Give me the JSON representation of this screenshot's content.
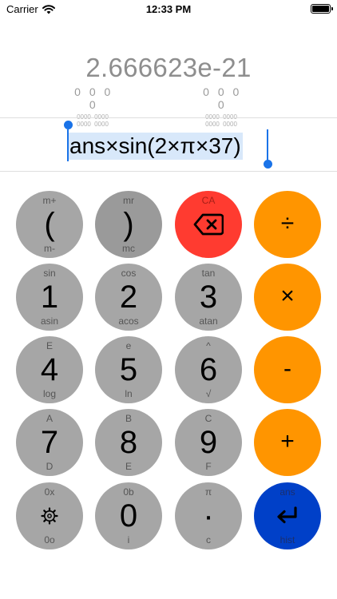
{
  "status_bar": {
    "carrier": "Carrier",
    "time": "12:33 PM",
    "icons": [
      "wifi-icon",
      "battery-icon"
    ]
  },
  "display": {
    "result": "2.666623e-21",
    "bit_groups": [
      {
        "digits": "0 0 0 0",
        "subs": "0000 0000 0000 0000"
      },
      {
        "digits": "0 0 0 0",
        "subs": "0000 0000 0000 0000"
      }
    ],
    "expression": "ans×sin(2×π×37)"
  },
  "colors": {
    "operator": "#ff9500",
    "delete": "#ff3b30",
    "enter": "#0040c8",
    "key": "#a6a6a6",
    "selection": "#1a73e8"
  },
  "keypad": {
    "open_paren": {
      "top": "m+",
      "main": "(",
      "bottom": "m-"
    },
    "close_paren": {
      "top": "mr",
      "main": ")",
      "bottom": "mc"
    },
    "backspace": {
      "top": "CA",
      "icon": "backspace-icon"
    },
    "divide": {
      "main": "÷"
    },
    "one": {
      "top": "sin",
      "main": "1",
      "bottom": "asin"
    },
    "two": {
      "top": "cos",
      "main": "2",
      "bottom": "acos"
    },
    "three": {
      "top": "tan",
      "main": "3",
      "bottom": "atan"
    },
    "multiply": {
      "main": "×"
    },
    "four": {
      "top": "E",
      "main": "4",
      "bottom": "log"
    },
    "five": {
      "top": "e",
      "main": "5",
      "bottom": "ln"
    },
    "six": {
      "top": "^",
      "main": "6",
      "bottom": "√"
    },
    "minus": {
      "main": "-"
    },
    "seven": {
      "top": "A",
      "main": "7",
      "bottom": "D"
    },
    "eight": {
      "top": "B",
      "main": "8",
      "bottom": "E"
    },
    "nine": {
      "top": "C",
      "main": "9",
      "bottom": "F"
    },
    "plus": {
      "main": "+"
    },
    "settings": {
      "top": "0x",
      "icon": "gear-icon",
      "bottom": "0o"
    },
    "zero": {
      "top": "0b",
      "main": "0",
      "bottom": "i"
    },
    "point": {
      "top": "π",
      "main": "·",
      "bottom": "c"
    },
    "enter": {
      "top": "ans",
      "icon": "return-icon",
      "bottom": "hist"
    }
  }
}
